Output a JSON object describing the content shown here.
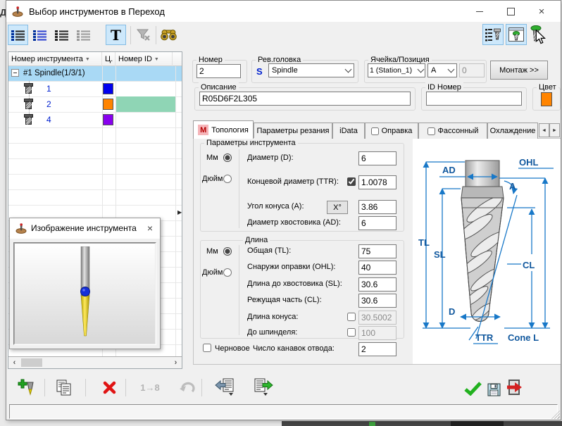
{
  "window": {
    "title": "Выбор инструментов в Переход"
  },
  "background_app": {
    "partial_text": "Д"
  },
  "glyphs": {
    "close": "×",
    "sort": "▼",
    "splitter": "▶",
    "scroll_left": "‹",
    "scroll_right": "›",
    "tab_left": "◄",
    "tab_right": "►",
    "dropdown": "▾",
    "renumber": "1→8"
  },
  "icons": {
    "titlebar": "tool-on-base",
    "view_buttons": "list-views",
    "text_filter": "T",
    "filter_clear": "funnel-x",
    "find": "binoculars",
    "tool_list_view": "list-with-tool",
    "tool_window_view": "window-with-tool",
    "tool_green": "green-head-tool",
    "add": "tool-plus",
    "copy": "documents",
    "delete": "red-x",
    "undo": "curl-arrow",
    "import": "sheet-arrow-left",
    "export": "sheet-arrow-right",
    "ok": "green-check",
    "save": "floppy",
    "exit": "door-red-arrow"
  },
  "toolbar_top": {
    "text_button": "T"
  },
  "tree": {
    "columns": {
      "tool_number": "Номер инструмента",
      "color": "Ц.",
      "id": "Номер ID"
    },
    "group_label": "#1 Spindle(1/3/1)",
    "selection_color": "#a9d9f5",
    "rows": [
      {
        "number": "1",
        "color": "#0000ee",
        "id_bg": ""
      },
      {
        "number": "2",
        "color": "#ff8400",
        "id_bg": "#8fd5b5"
      },
      {
        "number": "4",
        "color": "#8800ee",
        "id_bg": ""
      }
    ]
  },
  "tool_image_window": {
    "title": "Изображение инструмента"
  },
  "header_form": {
    "number_label": "Номер",
    "number_value": "2",
    "revhead_label": "Рев.головка",
    "revhead_prefix": "S",
    "revhead_value": "Spindle",
    "cellpos_label": "Ячейка/Позиция",
    "station_value": "1 (Station_1)",
    "position_value": "A",
    "position_index": "0",
    "mount_button_label": "Монтаж >>",
    "description_label": "Описание",
    "description_value": "R05D6F2L305",
    "id_label": "ID Номер",
    "id_value": "",
    "color_label": "Цвет",
    "tool_color": "#ff8400"
  },
  "tabs": {
    "active_badge": "M",
    "items": [
      "Топология",
      "Параметры резания",
      "iData",
      "Оправка",
      "Фассонный",
      "Охлаждение"
    ]
  },
  "topology": {
    "group1_title": "Параметры инструмента",
    "mm_label": "Мм",
    "inch_label": "Дюйм",
    "mm_selected": true,
    "diameter_label": "Диаметр (D):",
    "diameter_value": "6",
    "ttr_label": "Концевой диаметр (TTR):",
    "ttr_checked": true,
    "ttr_value": "1.0078",
    "angle_label": "Угол конуса (A):",
    "angle_button": "X°",
    "angle_value": "3.86",
    "shank_label": "Диаметр хвостовика (AD):",
    "shank_value": "6",
    "group2_title": "Длина",
    "tl_label": "Общая (TL):",
    "tl_value": "75",
    "ohl_label": "Снаружи оправки (OHL):",
    "ohl_value": "40",
    "sl_label": "Длина до хвостовика (SL):",
    "sl_value": "30.6",
    "cl_label": "Режущая часть (CL):",
    "cl_value": "30.6",
    "cone_label": "Длина конуса:",
    "cone_checked": false,
    "cone_value": "30.5002",
    "spindle_label": "До шпинделя:",
    "spindle_checked": false,
    "spindle_value": "100",
    "rough_label": "Черновое",
    "rough_checked": false,
    "flutes_label": "Число канавок отвода:",
    "flutes_value": "2"
  },
  "diagram": {
    "tl": "TL",
    "sl": "SL",
    "ad": "AD",
    "ohl": "OHL",
    "a": "A",
    "cl": "CL",
    "d": "D",
    "ttr": "TTR",
    "cone_l": "Cone L"
  },
  "status": {
    "text": ""
  }
}
